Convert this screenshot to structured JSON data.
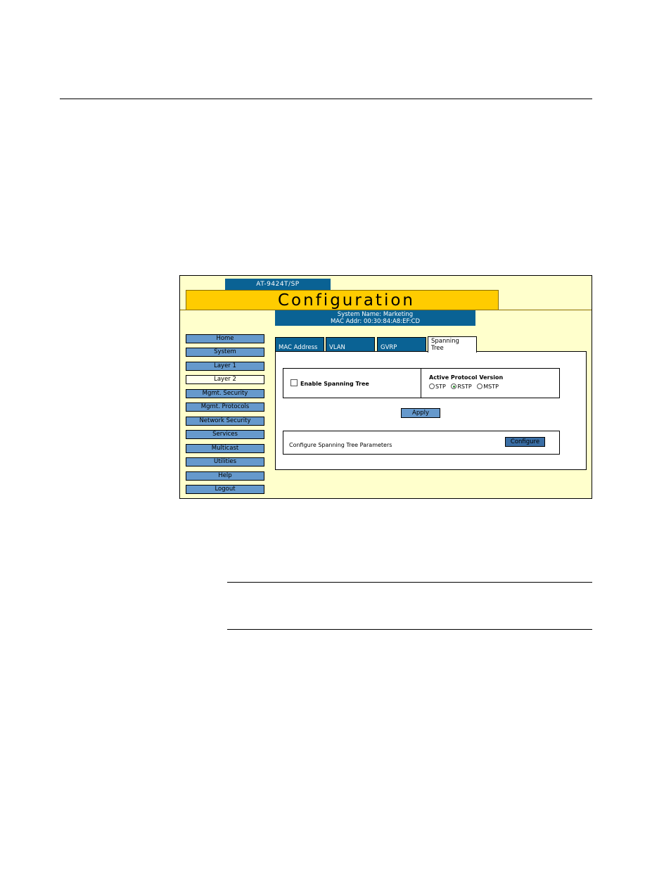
{
  "header": {
    "model": "AT-9424T/SP",
    "title": "Configuration",
    "system_name": "System Name: Marketing",
    "mac_addr": "MAC Addr: 00:30:84:A8:EF:CD"
  },
  "sidebar": {
    "items": [
      {
        "label": "Home"
      },
      {
        "label": "System"
      },
      {
        "label": "Layer 1"
      },
      {
        "label": "Layer 2"
      },
      {
        "label": "Mgmt. Security"
      },
      {
        "label": "Mgmt. Protocols"
      },
      {
        "label": "Network Security"
      },
      {
        "label": "Services"
      },
      {
        "label": "Multicast"
      },
      {
        "label": "Utilities"
      },
      {
        "label": "Help"
      },
      {
        "label": "Logout"
      }
    ],
    "active": "Layer 2"
  },
  "tabs": [
    {
      "label": "MAC Address"
    },
    {
      "label": "VLAN"
    },
    {
      "label": "GVRP"
    },
    {
      "label": "Spanning",
      "label2": "Tree"
    }
  ],
  "active_tab": "Spanning Tree",
  "stp": {
    "enable_label": "Enable Spanning Tree",
    "enabled": false,
    "protocol_label": "Active Protocol Version",
    "options": [
      "STP",
      "RSTP",
      "MSTP"
    ],
    "selected": "RSTP"
  },
  "apply_label": "Apply",
  "configure": {
    "label": "Configure Spanning Tree Parameters",
    "button": "Configure"
  },
  "colors": {
    "banner": "#ffcc00",
    "header_blue": "#0a6294",
    "nav_button": "#6699cc",
    "frame_bg": "#ffffcc"
  }
}
